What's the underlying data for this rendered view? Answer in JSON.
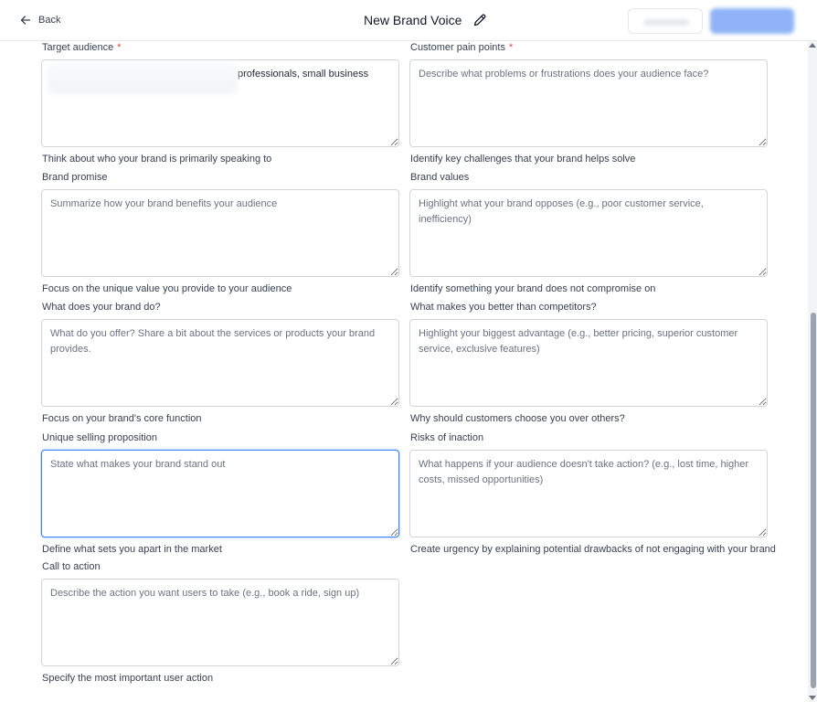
{
  "header": {
    "back_label": "Back",
    "title": "New Brand Voice"
  },
  "fields": [
    {
      "label": "Target audience",
      "required": "*",
      "value": "professionals, small business",
      "placeholder": "",
      "hint": "Think about who your brand is primarily speaking to"
    },
    {
      "label": "Customer pain points",
      "required": "*",
      "value": "",
      "placeholder": "Describe what problems or frustrations does your audience face?",
      "hint": "Identify key challenges that your brand helps solve"
    },
    {
      "label": "Brand promise",
      "value": "",
      "placeholder": "Summarize how your brand benefits your audience",
      "hint": "Focus on the unique value you provide to your audience"
    },
    {
      "label": "Brand values",
      "value": "",
      "placeholder": "Highlight what your brand opposes (e.g., poor customer service, inefficiency)",
      "hint": "Identify something your brand does not compromise on"
    },
    {
      "label": "What does your brand do?",
      "value": "",
      "placeholder": "What do you offer? Share a bit about the services or products your brand provides.",
      "hint": "Focus on your brand's core function"
    },
    {
      "label": "What makes you better than competitors?",
      "value": "",
      "placeholder": "Highlight your biggest advantage (e.g., better pricing, superior customer service, exclusive features)",
      "hint": "Why should customers choose you over others?"
    },
    {
      "label": "Unique selling proposition",
      "value": "",
      "placeholder": "State what makes your brand stand out",
      "hint": "Define what sets you apart in the market"
    },
    {
      "label": "Risks of inaction",
      "value": "",
      "placeholder": "What happens if your audience doesn't take action? (e.g., lost time, higher costs, missed opportunities)",
      "hint": "Create urgency by explaining potential drawbacks of not engaging with your brand"
    },
    {
      "label": "Call to action",
      "value": "",
      "placeholder": "Describe the action you want users to take (e.g., book a ride, sign up)",
      "hint": "Specify the most important user action"
    }
  ],
  "colors": {
    "focus_border": "#3b82f6",
    "primary_button": "#8fb3f6",
    "required_mark": "#ef4444"
  }
}
